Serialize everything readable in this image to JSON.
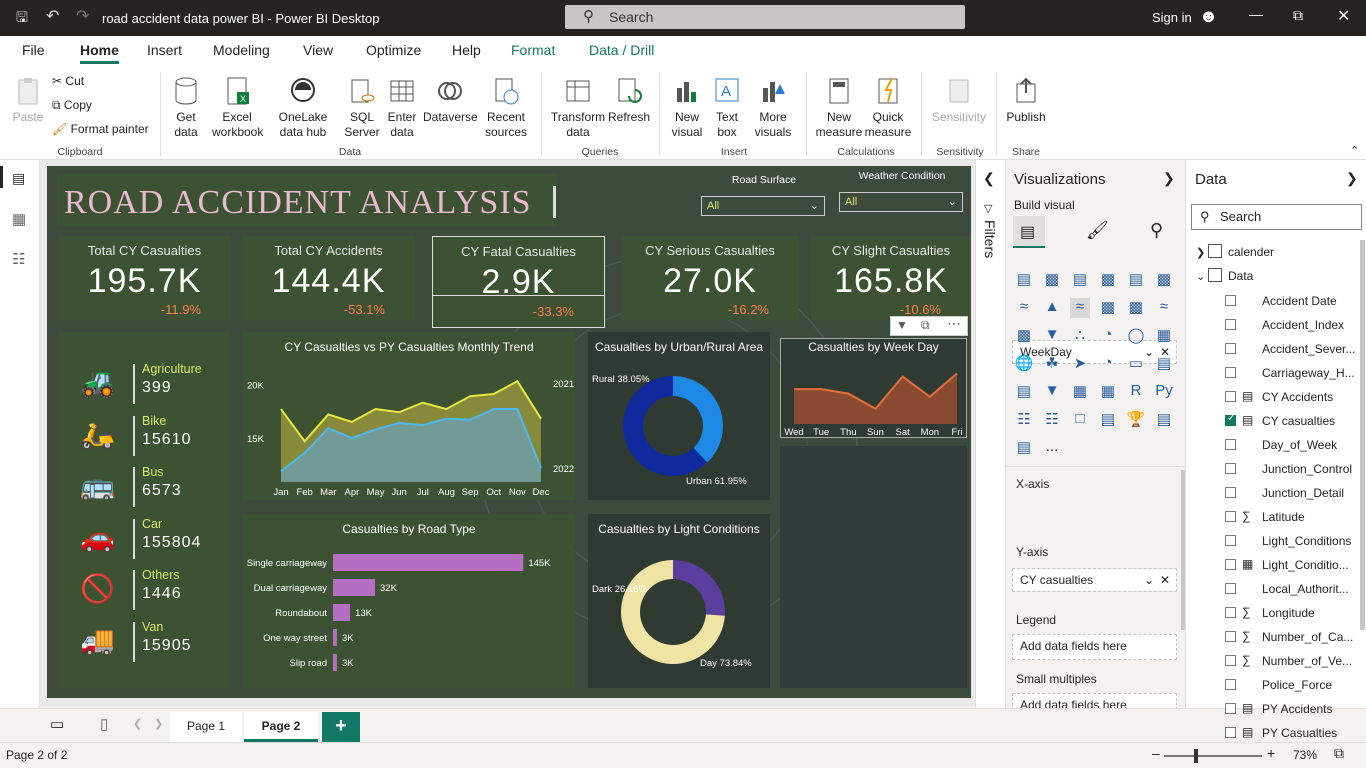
{
  "window": {
    "title": "road accident data power BI - Power BI Desktop",
    "search": "Search",
    "signin": "Sign in"
  },
  "menu": [
    "File",
    "Home",
    "Insert",
    "Modeling",
    "View",
    "Optimize",
    "Help",
    "Format",
    "Data / Drill"
  ],
  "ribbon": {
    "paste": "Paste",
    "cut": "Cut",
    "copy": "Copy",
    "format_painter": "Format painter",
    "clipboard": "Clipboard",
    "get_data": "Get data",
    "excel": "Excel workbook",
    "onelake": "OneLake data hub",
    "sql": "SQL Server",
    "enter_data": "Enter data",
    "dataverse": "Dataverse",
    "recent": "Recent sources",
    "data_group": "Data",
    "transform": "Transform data",
    "refresh": "Refresh",
    "queries": "Queries",
    "new_visual": "New visual",
    "text_box": "Text box",
    "more_visuals": "More visuals",
    "insert": "Insert",
    "new_measure": "New measure",
    "quick_measure": "Quick measure",
    "calculations": "Calculations",
    "sensitivity": "Sensitivity",
    "sensitivity_group": "Sensitivity",
    "publish": "Publish",
    "share": "Share"
  },
  "report": {
    "title": "ROAD ACCIDENT ANALYSIS",
    "slicers": [
      {
        "label": "Road Surface",
        "value": "All"
      },
      {
        "label": "Weather Condition",
        "value": "All"
      }
    ],
    "kpis": [
      {
        "label": "Total CY Casualties",
        "value": "195.7K",
        "delta": "-11.9%"
      },
      {
        "label": "Total CY Accidents",
        "value": "144.4K",
        "delta": "-53.1%"
      },
      {
        "label": "CY Fatal Casualties",
        "value": "2.9K",
        "delta": "-33.3%"
      },
      {
        "label": "CY Serious Casualties",
        "value": "27.0K",
        "delta": "-16.2%"
      },
      {
        "label": "CY Slight Casualties",
        "value": "165.8K",
        "delta": "-10.6%"
      }
    ],
    "vehicles": [
      {
        "name": "Agriculture",
        "value": "399",
        "icon": "tractor-icon"
      },
      {
        "name": "Bike",
        "value": "15610",
        "icon": "bike-icon"
      },
      {
        "name": "Bus",
        "value": "6573",
        "icon": "bus-icon"
      },
      {
        "name": "Car",
        "value": "155804",
        "icon": "car-icon"
      },
      {
        "name": "Others",
        "value": "1446",
        "icon": "no-entry-icon"
      },
      {
        "name": "Van",
        "value": "15905",
        "icon": "van-icon"
      }
    ]
  },
  "chart_data": [
    {
      "type": "area",
      "title": "CY Casualties vs PY Casualties Monthly Trend",
      "categories": [
        "Jan",
        "Feb",
        "Mar",
        "Apr",
        "May",
        "Jun",
        "Jul",
        "Aug",
        "Sep",
        "Oct",
        "Nov",
        "Dec"
      ],
      "yticks": [
        "20K",
        "15K"
      ],
      "ylim": [
        11000,
        22000
      ],
      "series": [
        {
          "name": "2021",
          "values": [
            17800,
            14800,
            17300,
            16600,
            17800,
            17500,
            18400,
            17800,
            19000,
            19200,
            20400,
            16900
          ]
        },
        {
          "name": "2022",
          "values": [
            12000,
            13700,
            16000,
            15100,
            15900,
            16500,
            16300,
            16900,
            16800,
            17800,
            17800,
            12300
          ]
        }
      ]
    },
    {
      "type": "pie",
      "title": "Casualties by Urban/Rural Area",
      "labels": [
        "Rural",
        "Urban"
      ],
      "values": [
        38.05,
        61.95
      ],
      "label_text": [
        "Rural 38.05%",
        "Urban 61.95%"
      ]
    },
    {
      "type": "area",
      "title": "Casualties by Week Day",
      "categories": [
        "Wed",
        "Tue",
        "Thu",
        "Sun",
        "Sat",
        "Mon",
        "Fri"
      ],
      "values": [
        27500,
        27500,
        26800,
        24400,
        29500,
        26300,
        30000
      ],
      "ylim": [
        22000,
        31000
      ]
    },
    {
      "type": "bar",
      "title": "Casualties by Road Type",
      "categories": [
        "Single carriageway",
        "Dual carriageway",
        "Roundabout",
        "One way street",
        "Slip road"
      ],
      "values": [
        145,
        32,
        13,
        3,
        3
      ],
      "value_labels": [
        "145K",
        "32K",
        "13K",
        "3K",
        "3K"
      ],
      "xlim": [
        0,
        160
      ]
    },
    {
      "type": "pie",
      "title": "Casualties by Light Conditions",
      "labels": [
        "Dark",
        "Day"
      ],
      "values": [
        26.16,
        73.84
      ],
      "label_text": [
        "Dark 26.16%",
        "Day 73.84%"
      ]
    }
  ],
  "visualizations": {
    "title": "Visualizations",
    "build": "Build visual",
    "xaxis_label": "X-axis",
    "xaxis_field": "WeekDay",
    "yaxis_label": "Y-axis",
    "yaxis_field": "CY casualties",
    "legend": "Legend",
    "legend_placeholder": "Add data fields here",
    "small_multiples": "Small multiples",
    "small_placeholder": "Add data fields here",
    "more": "..."
  },
  "filters": "Filters",
  "data_pane": {
    "title": "Data",
    "search": "Search",
    "tables": [
      "calender",
      "Data"
    ],
    "fields": [
      "Accident Date",
      "Accident_Index",
      "Accident_Sever...",
      "Carriageway_H...",
      "CY Accidents",
      "CY casualties",
      "Day_of_Week",
      "Junction_Control",
      "Junction_Detail",
      "Latitude",
      "Light_Conditions",
      "Light_Conditio...",
      "Local_Authorit...",
      "Longitude",
      "Number_of_Ca...",
      "Number_of_Ve...",
      "Police_Force",
      "PY Accidents",
      "PY Casualties"
    ]
  },
  "pages": [
    "Page 1",
    "Page 2"
  ],
  "status": {
    "page": "Page 2 of 2",
    "zoom": "73%"
  }
}
